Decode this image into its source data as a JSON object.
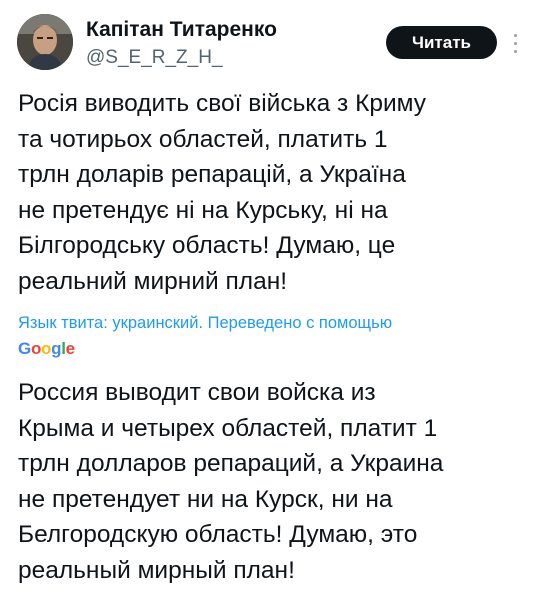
{
  "author": {
    "name": "Капітан Титаренко",
    "handle": "@S_E_R_Z_H_"
  },
  "actions": {
    "follow_label": "Читать",
    "more_icon": "more-vertical-icon"
  },
  "tweet": {
    "original_text": "Росія виводить свої війська з Криму\nта чотирьох областей, платить 1\nтрлн доларів репарацій, а Україна\nне претендує ні на Курську, ні на\nБілгородську область!  Думаю, це\nреальний мирний план!",
    "translation_label": "Язык твита: украинский. Переведено с помощью",
    "translator_logo": [
      "G",
      "o",
      "o",
      "g",
      "l",
      "e"
    ],
    "translated_text": "Россия выводит свои войска из\nКрыма и четырех областей, платит 1\nтрлн долларов репараций, а Украина\nне претендует ни на Курск, ни на\nБелгородскую область! Думаю, это\nреальный мирный план!"
  },
  "colors": {
    "accent": "#1d9bf0",
    "text": "#0f1419",
    "secondary": "#536471",
    "button_bg": "#0f1419"
  }
}
